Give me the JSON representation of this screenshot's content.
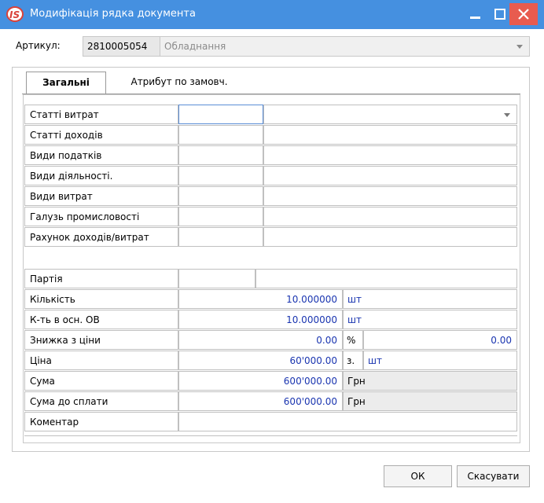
{
  "window": {
    "title": "Модифікація рядка документа",
    "logo_text": "IS"
  },
  "artikul": {
    "label": "Артикул:",
    "code": "2810005054",
    "name": "Обладнання"
  },
  "tabs": [
    {
      "label": "Загальні",
      "active": true
    },
    {
      "label": "Атрибут по замовч.",
      "active": false
    }
  ],
  "fields": {
    "statti_vytrat": "Статті витрат",
    "statti_dokhodiv": "Статті доходів",
    "vydy_podatkiv": "Види податків",
    "vydy_diyalnosti": "Види діяльності.",
    "vydy_vytrat": "Види витрат",
    "haluz": "Галузь промисловості",
    "rakhunok": "Рахунок доходів/витрат",
    "partiya": "Партія"
  },
  "kilkist": {
    "label": "Кількість",
    "value": "10.000000",
    "unit": "шт"
  },
  "kt_osn": {
    "label": "К-ть в осн. ОВ",
    "value": "10.000000",
    "unit": "шт"
  },
  "znyzhka": {
    "label": "Знижка з ціни",
    "value": "0.00",
    "unit": "%",
    "value2": "0.00"
  },
  "tsina": {
    "label": "Ціна",
    "value": "60'000.00",
    "prefix": "з.",
    "unit": "шт"
  },
  "suma": {
    "label": "Сума",
    "value": "600'000.00",
    "currency": "Грн"
  },
  "suma_splaty": {
    "label": "Сума до сплати",
    "value": "600'000.00",
    "currency": "Грн"
  },
  "komentar": {
    "label": "Коментар",
    "value": ""
  },
  "buttons": {
    "ok": "ОК",
    "cancel": "Скасувати"
  },
  "colors": {
    "titlebar": "#4590e0",
    "close": "#e85b4f",
    "value_text": "#1a35b0"
  }
}
